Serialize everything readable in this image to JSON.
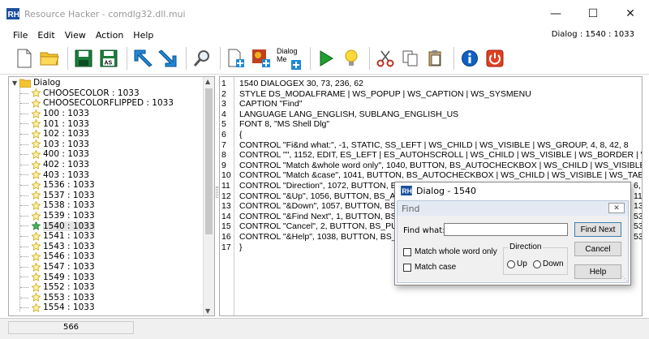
{
  "window": {
    "title": "Resource Hacker - comdlg32.dll.mui",
    "minimize": "—",
    "maximize": "☐",
    "close": "✕"
  },
  "menu": {
    "items": [
      "File",
      "Edit",
      "View",
      "Action",
      "Help"
    ],
    "right_info": "Dialog : 1540 : 1033"
  },
  "toolbar": {
    "dialog_label_1": "Dialog",
    "dialog_label_2": "Me"
  },
  "tree": {
    "root": "Dialog",
    "items": [
      "CHOOSECOLOR : 1033",
      "CHOOSECOLORFLIPPED : 1033",
      "100 : 1033",
      "101 : 1033",
      "102 : 1033",
      "103 : 1033",
      "400 : 1033",
      "402 : 1033",
      "403 : 1033",
      "1536 : 1033",
      "1537 : 1033",
      "1538 : 1033",
      "1539 : 1033",
      "1540 : 1033",
      "1541 : 1033",
      "1543 : 1033",
      "1546 : 1033",
      "1547 : 1033",
      "1549 : 1033",
      "1552 : 1033",
      "1553 : 1033",
      "1554 : 1033"
    ],
    "selected_index": 13
  },
  "editor": {
    "lines": [
      "1540 DIALOGEX 30, 73, 236, 62",
      "STYLE DS_MODALFRAME | WS_POPUP | WS_CAPTION | WS_SYSMENU",
      "CAPTION \"Find\"",
      "LANGUAGE LANG_ENGLISH, SUBLANG_ENGLISH_US",
      "FONT 8, \"MS Shell Dlg\"",
      "{",
      "   CONTROL \"Fi&nd what:\", -1, STATIC, SS_LEFT | WS_CHILD | WS_VISIBLE | WS_GROUP, 4, 8, 42, 8",
      "   CONTROL \"\", 1152, EDIT, ES_LEFT | ES_AUTOHSCROLL | WS_CHILD | WS_VISIBLE | WS_BORDER | WS_",
      "   CONTROL \"Match &whole word only\", 1040, BUTTON, BS_AUTOCHECKBOX | WS_CHILD | WS_VISIBLE | W",
      "   CONTROL \"Match &case\", 1041, BUTTON, BS_AUTOCHECKBOX | WS_CHILD | WS_VISIBLE | WS_TABSTO",
      "   CONTROL \"Direction\", 1072, BUTTON, BS",
      "   CONTROL \"&Up\", 1056, BUTTON, BS_AU",
      "   CONTROL \"&Down\", 1057, BUTTON, BS_A",
      "   CONTROL \"&Find Next\", 1, BUTTON, BS",
      "   CONTROL \"Cancel\", 2, BUTTON, BS_PUS",
      "   CONTROL \"&Help\", 1038, BUTTON, BS_PU",
      "}"
    ],
    "right_overflow": [
      "6, (",
      "11,",
      "13,",
      "53, 59",
      "53, 3",
      "53, 3"
    ]
  },
  "status": {
    "value": "566"
  },
  "preview": {
    "outer_title": "Dialog - 1540",
    "inner_title": "Find",
    "close": "✕",
    "find_label": "Find what:",
    "find_value": "",
    "find_next": "Find Next",
    "cancel": "Cancel",
    "help": "Help",
    "match_whole": "Match whole word only",
    "match_case": "Match case",
    "direction": "Direction",
    "up": "Up",
    "down": "Down"
  },
  "colors": {
    "accent": "#3c7fb1",
    "selection": "#e5e5e5",
    "play_green": "#1e9e2e",
    "info_blue": "#1060c0",
    "power_red": "#e04020"
  }
}
